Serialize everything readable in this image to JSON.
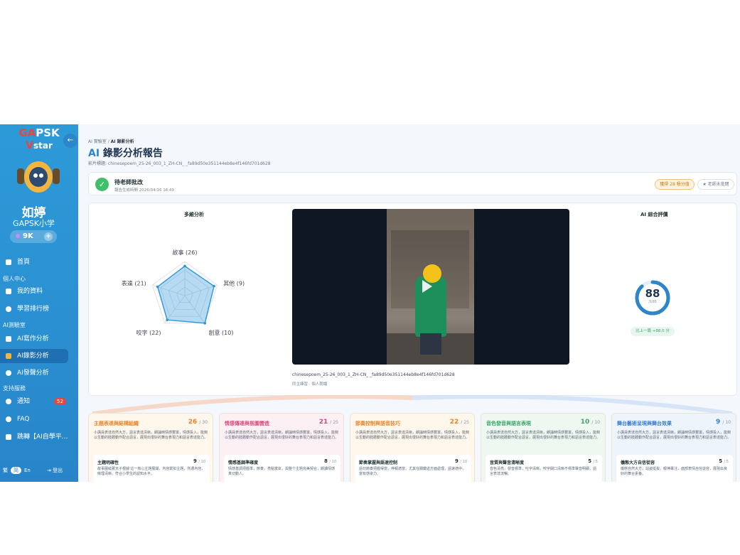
{
  "sidebar": {
    "logo_line1_ga": "GA",
    "logo_line1_rest": "PSK",
    "logo_line2_v": "V",
    "logo_line2_rest": "star",
    "username": "如婷",
    "school": "GAPSK小学",
    "points": "9K",
    "plus": "+",
    "items": [
      {
        "label": "首頁"
      },
      {
        "label": "我的資料"
      },
      {
        "label": "學習排行榜"
      },
      {
        "label": "AI寫作分析"
      },
      {
        "label": "AI錄影分析"
      },
      {
        "label": "AI發聲分析"
      },
      {
        "label": "通知"
      },
      {
        "label": "FAQ"
      },
      {
        "label": "跳轉【AI自學平..."
      }
    ],
    "sections": [
      "個人中心",
      "AI測驗室",
      "支持服務"
    ],
    "notify_badge": "52",
    "lang": [
      "繁",
      "简",
      "En"
    ],
    "logout": "登出",
    "collapse": "←"
  },
  "header": {
    "crumb_parent": "AI 實驗室 / ",
    "crumb_current": "AI 錄影分析",
    "title_ai": "AI",
    "title_rest": " 錄影分析報告",
    "subtitle": "影片標題: chinesepoem_25-26_003_1_ZH-CN_        _fa89d50e351144eb8e4f146fd701d628"
  },
  "status": {
    "title": "待老師批改",
    "time": "報告生成時間 2026/04/16 16:49",
    "earn": "獲得 28 積分值",
    "review": "★ 老師未批閱"
  },
  "radar": {
    "title": "多維分析",
    "labels": [
      "故事 (26)",
      "其他 (9)",
      "創意 (10)",
      "咬字 (22)",
      "表達 (21)"
    ]
  },
  "chart_data": {
    "type": "radar",
    "categories": [
      "故事",
      "其他",
      "創意",
      "咬字",
      "表達"
    ],
    "values": [
      26,
      9,
      10,
      22,
      21
    ],
    "max": [
      30,
      10,
      10,
      25,
      25
    ]
  },
  "video": {
    "name": "chinesepoem_25-26_003_1_ZH-CN_        _fa89d50e351144eb8e4f146fd701d628",
    "sub": "同主練習 · 個人朗誦"
  },
  "overall": {
    "title": "AI 綜合評價",
    "score": "88",
    "score_value": 88,
    "den": "/100",
    "delta": "比上一篇 +88.0 分"
  },
  "dims": [
    {
      "title": "主題表達與結構組織",
      "score": "26",
      "max": "/ 30",
      "color": "#e8862a",
      "bg": "#fff6ec",
      "text": "小講員表達自然大方，語言表達清晰，朗誦時情感豐富，情感投入，能夠以生動的肢體動作配合語言，展現出很好的舞台表現力和語言表達能力。",
      "sub_title": "主題明確性",
      "sub_score": "9",
      "sub_max": "/ 10",
      "sub_text": "故事圍繞著天子根據'這一核心主題展開，內容緊扣主題，所選內容，條理清晰，符合小學生的認知水平。"
    },
    {
      "title": "情感傳達與氛圍營造",
      "score": "21",
      "max": "/ 25",
      "color": "#d64a7a",
      "bg": "#fdf0f4",
      "text": "小講員表達自然大方，語言表達清晰，朗誦時情感豐富，情感投入，能夠以生動的肢體動作配合語言，展現出很好的舞台表現力和語言表達能力。",
      "sub_title": "情感基調準確度",
      "sub_score": "8",
      "sub_max": "/ 10",
      "sub_text": "情感基調把握準，節奏，亮點富氣，與整个主題完美契合，朗讀情感真切動人。"
    },
    {
      "title": "節奏控制與語音技巧",
      "score": "22",
      "max": "/ 25",
      "color": "#e8862a",
      "bg": "#fff6ec",
      "text": "小講員表達自然大方，語言表達清晰，朗誦時情感豐富，情感投入，能夠以生動的肢體動作配合語言，展現出很好的舞台表現力和語言表達能力。",
      "sub_title": "節奏掌握與語速控制",
      "sub_score": "9",
      "sub_max": "/ 10",
      "sub_text": "語句節奏把握得當，停頓適當，尤其在關鍵處方面處理，語速適中，富有感染力。"
    },
    {
      "title": "音色發音與語言表現",
      "score": "10",
      "max": "/ 10",
      "color": "#3fa56a",
      "bg": "#eef8f1",
      "text": "小講員表達自然大方，語言表達清晰，朗誦時情感豐富，情感投入，能夠以生動的肢體動作配合語言，展現出很好的舞台表現力和語言表達能力。",
      "sub_title": "音質與聲音清晰度",
      "sub_score": "5",
      "sub_max": "/ 5",
      "sub_text": "音色清亮，發音標準，吐字清晰，咬字開口清晰不標準聲音明顯，語言表達流暢。"
    },
    {
      "title": "舞台藝術呈現與舞台效果",
      "score": "9",
      "max": "/ 10",
      "color": "#3a7ccf",
      "bg": "#eef4fc",
      "text": "小講員表達自然大方，語言表達清晰，朗誦時情感豐富，情感投入，能夠以生動的肢體動作配合語言，展現出很好的舞台表現力和語言表達能力。",
      "sub_title": "儀態大方自信從容",
      "sub_score": "5",
      "sub_max": "/ 5",
      "sub_text": "儀態自然大方，站姿挺拔，眼神專注，面部表情自信從容，展現出良好的舞台素養。"
    }
  ]
}
